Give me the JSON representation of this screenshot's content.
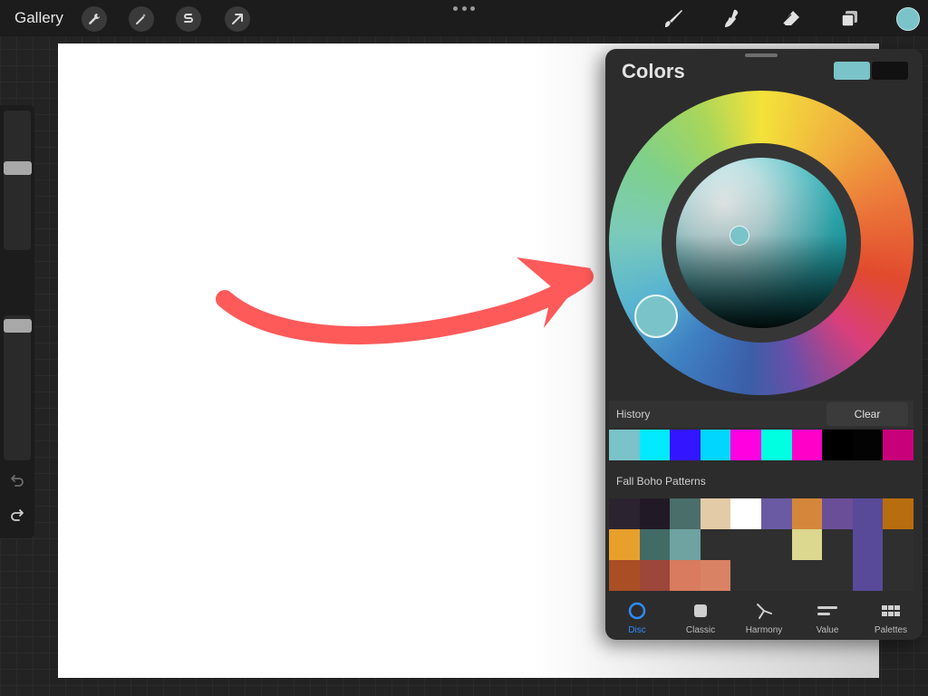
{
  "topbar": {
    "gallery_label": "Gallery",
    "left_tools": [
      "wrench-icon",
      "magic-wand-icon",
      "selection-s-icon",
      "transform-arrow-icon"
    ],
    "right_tools": [
      "brush-icon",
      "smudge-icon",
      "eraser-icon",
      "layers-icon"
    ],
    "current_color": "#7ac3c9"
  },
  "panel": {
    "title": "Colors",
    "primary_swatch": "#7ac3c9",
    "secondary_swatch": "#111111",
    "history": {
      "label": "History",
      "clear_label": "Clear",
      "colors": [
        "#7ac3c9",
        "#00eaff",
        "#3316ff",
        "#00d6ff",
        "#ff00e1",
        "#00ffe1",
        "#ff00c8",
        "#000000",
        "#030303",
        "#c8007a"
      ]
    },
    "palette": {
      "name": "Fall Boho Patterns",
      "colors": [
        "#2b2430",
        "#211a26",
        "#4a6e69",
        "#e3cba7",
        "#ffffff",
        "#6a5aa3",
        "#d4873a",
        "#6b4e98",
        "#584a99",
        "#b86e0e",
        "#e8a02c",
        "#436b66",
        "#6ea3a1",
        "#2f2f2f",
        "#2f2f2f",
        "#2f2f2f",
        "#dcd88f",
        "#2f2f2f",
        "#584a99",
        "#2f2f2f",
        "#a94e25",
        "#9d463a",
        "#d87b5e",
        "#da8264",
        "#2f2f2f",
        "#2f2f2f",
        "#2f2f2f",
        "#2f2f2f",
        "#584a99",
        "#2f2f2f"
      ]
    },
    "tabs": [
      {
        "label": "Disc",
        "icon": "disc-icon",
        "active": true
      },
      {
        "label": "Classic",
        "icon": "classic-square-icon",
        "active": false
      },
      {
        "label": "Harmony",
        "icon": "harmony-icon",
        "active": false
      },
      {
        "label": "Value",
        "icon": "value-sliders-icon",
        "active": false
      },
      {
        "label": "Palettes",
        "icon": "palettes-grid-icon",
        "active": false
      }
    ]
  },
  "canvas": {
    "annotation_color": "#ff5a5a"
  }
}
